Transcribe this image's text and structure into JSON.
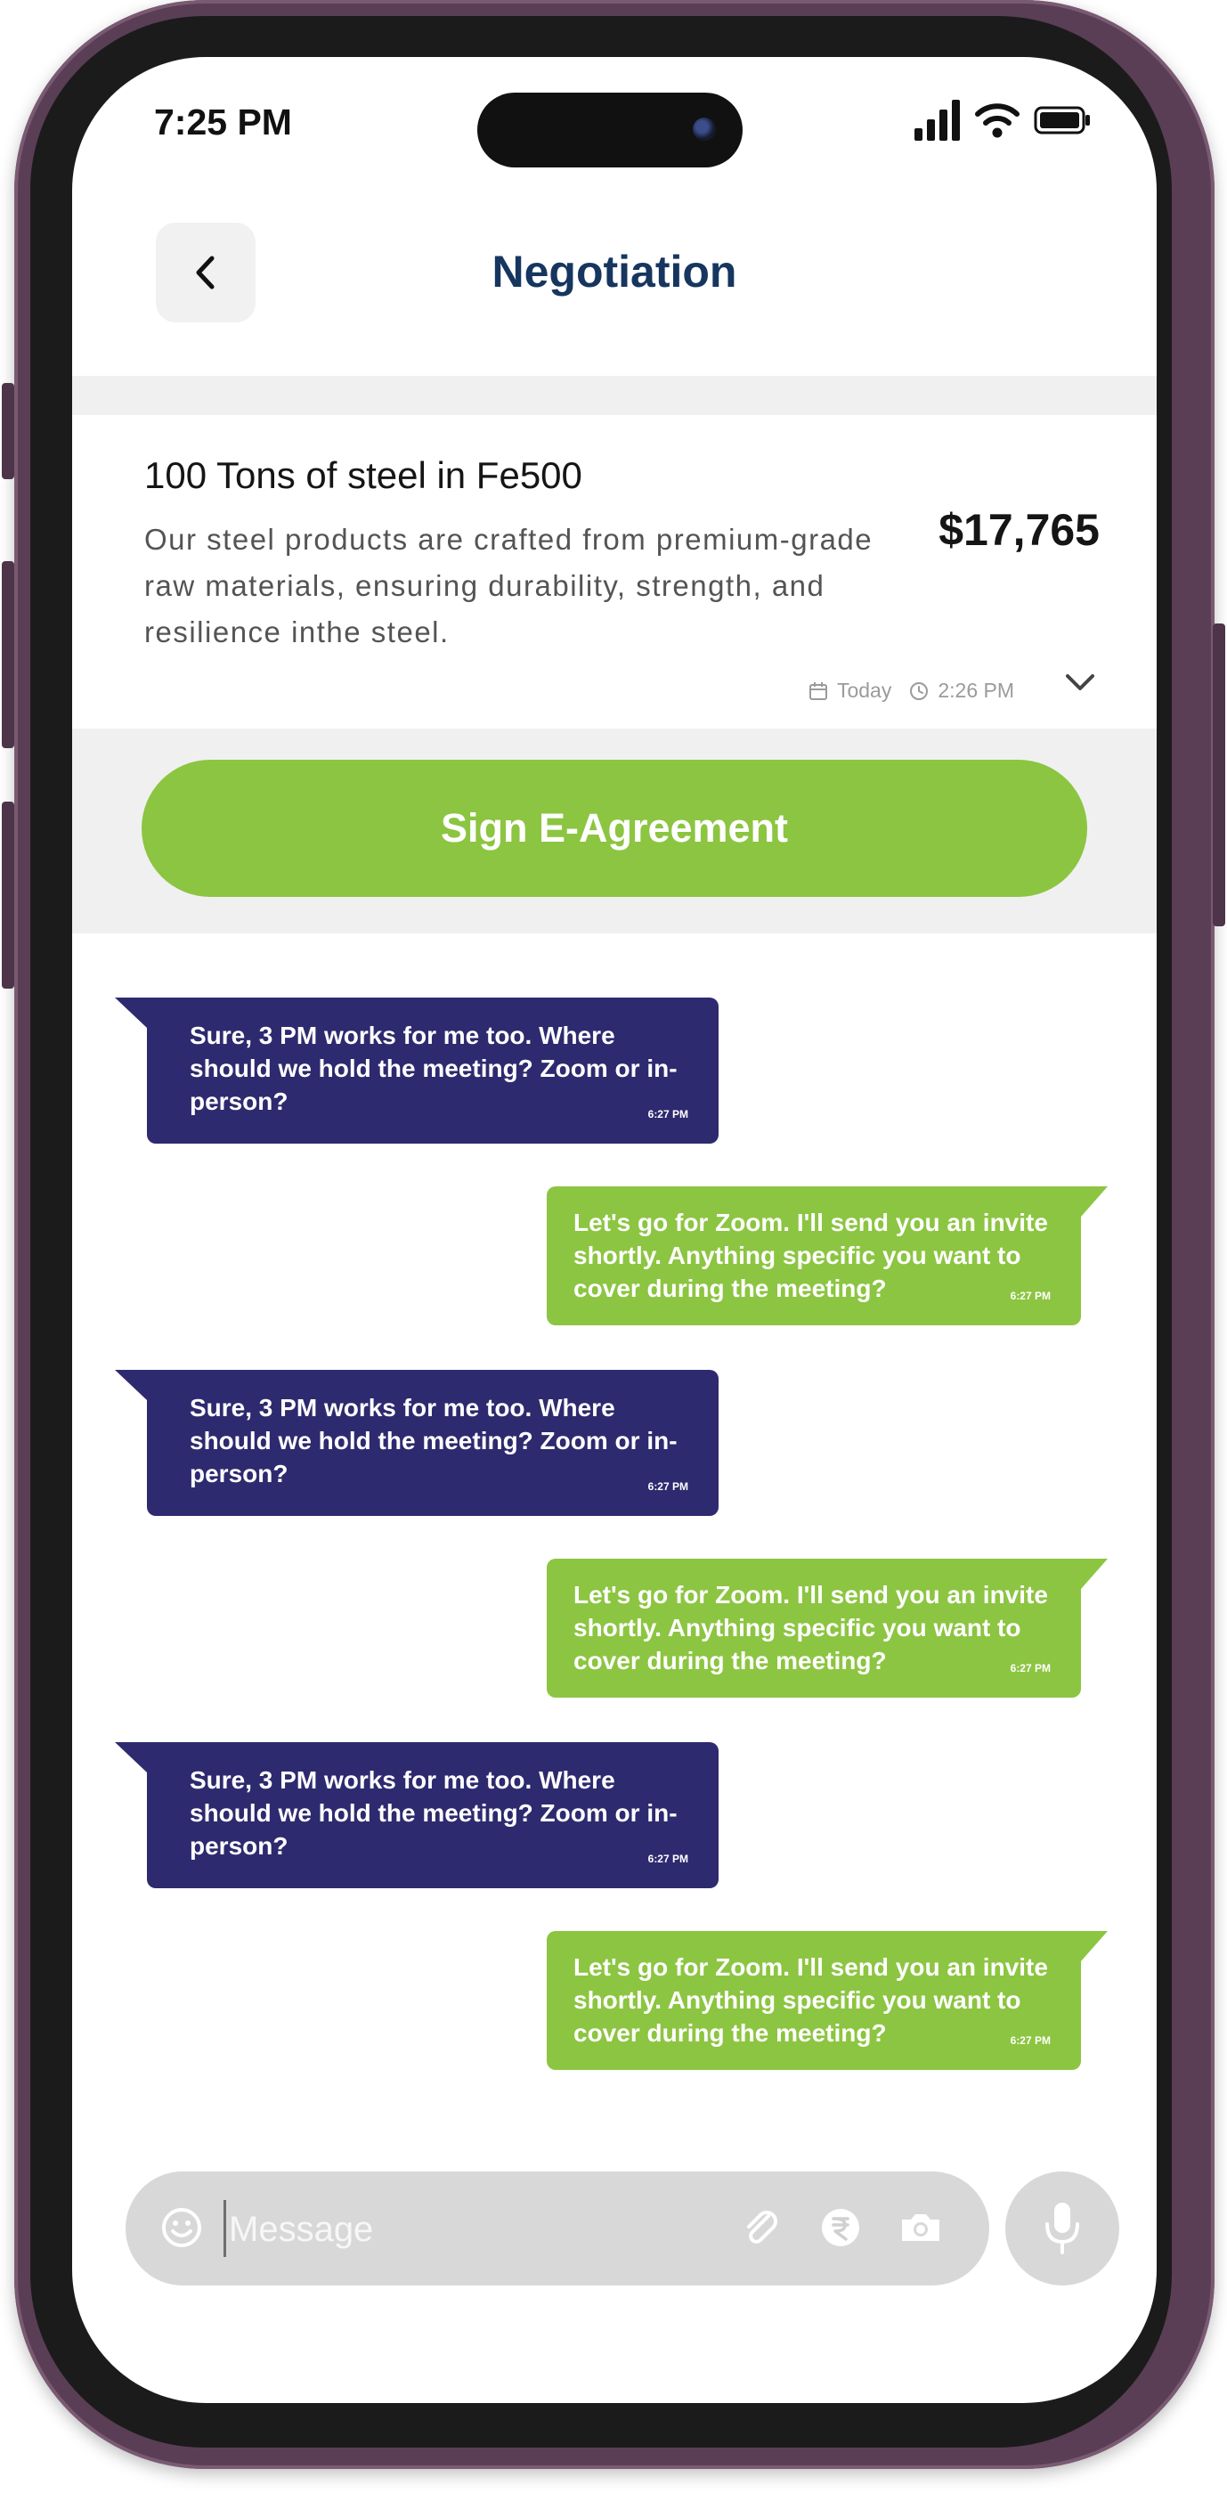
{
  "status_bar": {
    "time": "7:25 PM",
    "icons": [
      "cellular-signal-icon",
      "wifi-icon",
      "battery-icon"
    ]
  },
  "header": {
    "title": "Negotiation",
    "back_icon": "chevron-left-icon"
  },
  "product": {
    "title": "100 Tons of steel in Fe500",
    "description": "Our steel products are crafted from premium-grade raw materials, ensuring durability, strength, and resilience inthe steel.",
    "price": "$17,765",
    "date": "Today",
    "time": "2:26 PM",
    "expand_icon": "chevron-down-icon"
  },
  "actions": {
    "sign_label": "Sign E-Agreement"
  },
  "messages": [
    {
      "direction": "in",
      "text": "Sure, 3 PM works for me too. Where should we hold the meeting? Zoom or in-person?",
      "time": "6:27 PM"
    },
    {
      "direction": "out",
      "text": "Let's go for Zoom. I'll send you an invite shortly. Anything specific you want to cover during the meeting?",
      "time": "6:27 PM"
    },
    {
      "direction": "in",
      "text": "Sure, 3 PM works for me too. Where should we hold the meeting? Zoom or in-person?",
      "time": "6:27 PM"
    },
    {
      "direction": "out",
      "text": "Let's go for Zoom. I'll send you an invite shortly. Anything specific you want to cover during the meeting?",
      "time": "6:27 PM"
    },
    {
      "direction": "in",
      "text": "Sure, 3 PM works for me too. Where should we hold the meeting? Zoom or in-person?",
      "time": "6:27 PM"
    },
    {
      "direction": "out",
      "text": "Let's go for Zoom. I'll send you an invite shortly. Anything specific you want to cover during the meeting?",
      "time": "6:27 PM"
    }
  ],
  "composer": {
    "placeholder": "Message",
    "icons": [
      "emoji-icon",
      "attachment-icon",
      "rupee-icon",
      "camera-icon",
      "microphone-icon"
    ]
  },
  "colors": {
    "accent_green": "#8cc541",
    "incoming_bubble": "#2e2a6f",
    "title_navy": "#16365f",
    "band_gray": "#f0f0f0"
  }
}
